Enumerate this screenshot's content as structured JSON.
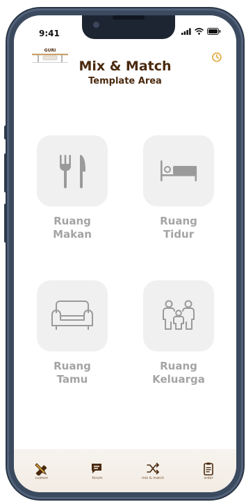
{
  "status": {
    "time": "9:41"
  },
  "header": {
    "logo_text": "GURI",
    "title": "Mix & Match",
    "subtitle": "Template Area"
  },
  "rooms": [
    {
      "label": "Ruang\nMakan",
      "icon": "dining-icon"
    },
    {
      "label": "Ruang\nTidur",
      "icon": "bed-icon"
    },
    {
      "label": "Ruang\nTamu",
      "icon": "sofa-icon"
    },
    {
      "label": "Ruang\nKeluarga",
      "icon": "family-icon"
    }
  ],
  "nav": [
    {
      "label": "custom",
      "icon": "pencil-ruler-icon"
    },
    {
      "label": "forum",
      "icon": "chat-icon"
    },
    {
      "label": "mix & match",
      "icon": "mix-match-icon"
    },
    {
      "label": "order",
      "icon": "clipboard-icon"
    }
  ],
  "colors": {
    "title": "#4a2a0e",
    "accent": "#e0a83a",
    "tile_bg": "#f0f0f0",
    "tile_icon": "#9a9a9a",
    "label": "#a4a4a4"
  }
}
